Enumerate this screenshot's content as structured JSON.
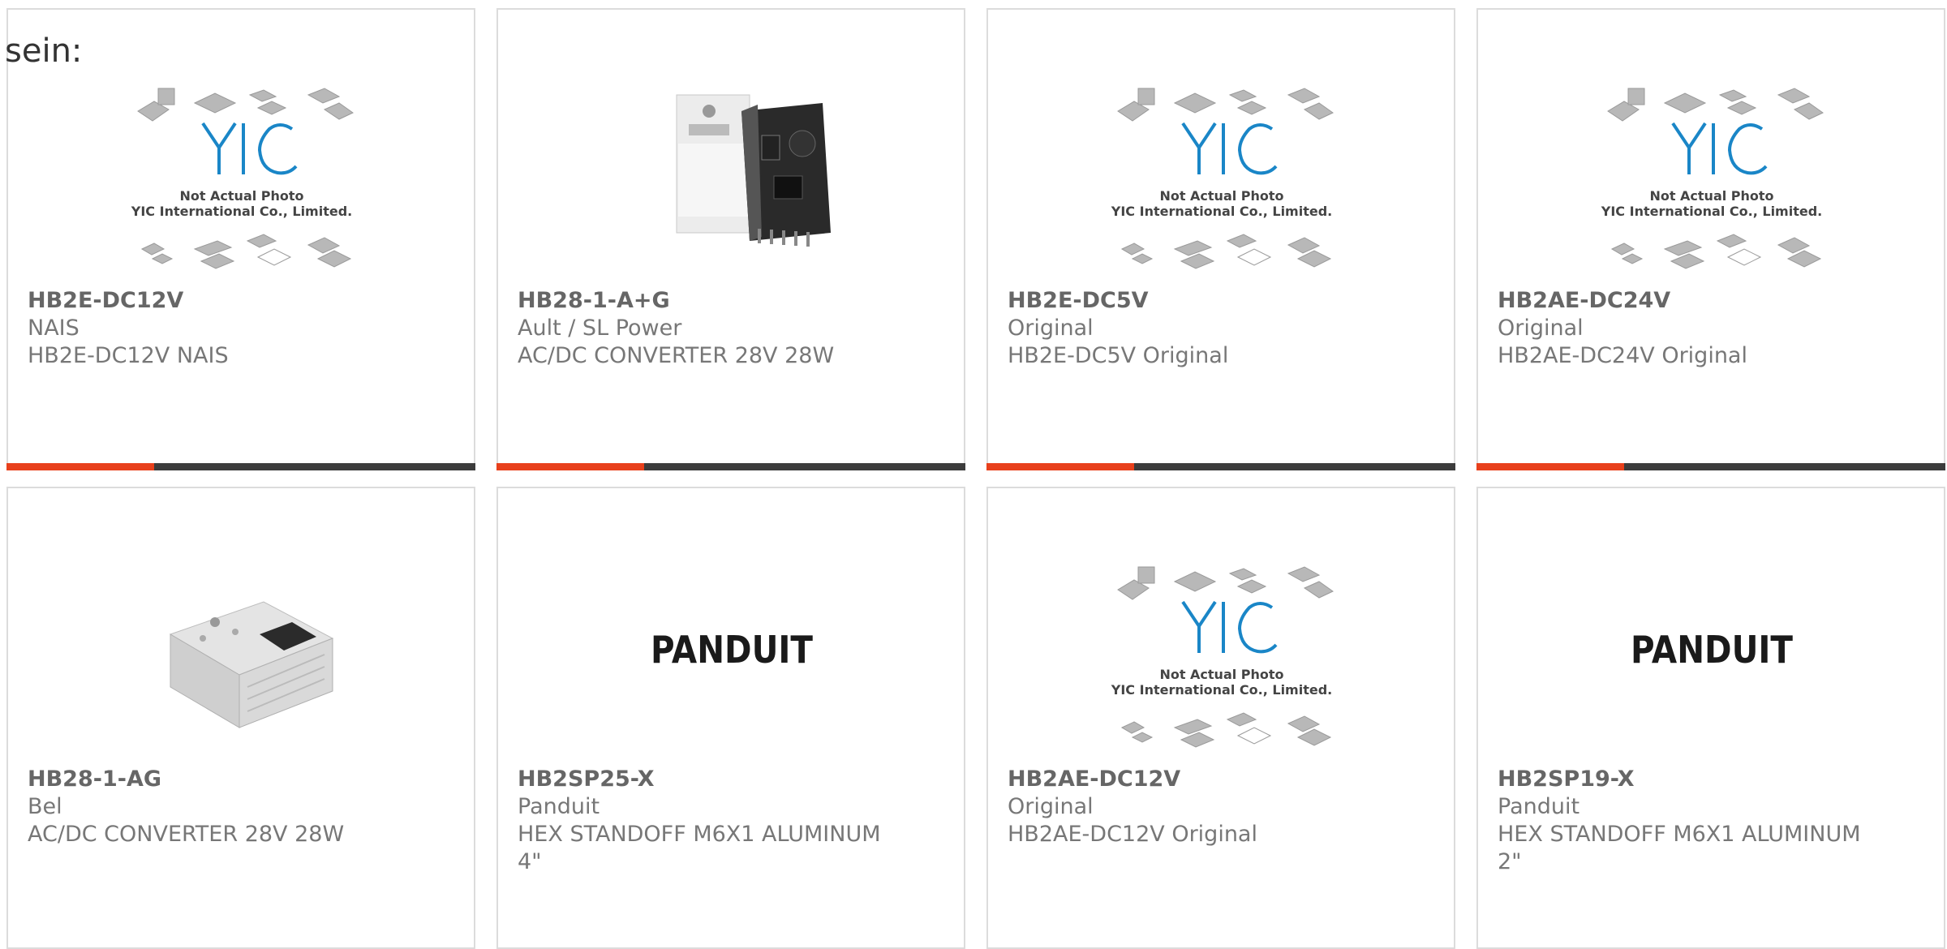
{
  "heading": "sein:",
  "placeholder": {
    "logo": "YIC",
    "line1": "Not Actual Photo",
    "line2": "YIC International Co., Limited."
  },
  "brand": {
    "panduit": "PANDUIT"
  },
  "colors": {
    "accent": "#e8401c",
    "bar": "#3c3c3c",
    "border": "#dcdcdc",
    "yic_blue": "#1a86c7"
  },
  "products": [
    {
      "part": "HB2E-DC12V",
      "mfr": "NAIS",
      "desc": "HB2E-DC12V NAIS",
      "image": "yic-placeholder"
    },
    {
      "part": "HB28-1-A+G",
      "mfr": "Ault / SL Power",
      "desc": "AC/DC CONVERTER 28V 28W",
      "image": "power-supply-open"
    },
    {
      "part": "HB2E-DC5V",
      "mfr": "Original",
      "desc": "HB2E-DC5V Original",
      "image": "yic-placeholder"
    },
    {
      "part": "HB2AE-DC24V",
      "mfr": "Original",
      "desc": "HB2AE-DC24V Original",
      "image": "yic-placeholder"
    },
    {
      "part": "HB28-1-AG",
      "mfr": "Bel",
      "desc": "AC/DC CONVERTER 28V 28W",
      "image": "power-supply-enclosed"
    },
    {
      "part": "HB2SP25-X",
      "mfr": "Panduit",
      "desc": "HEX STANDOFF M6X1 ALUMINUM\n4\"",
      "image": "panduit-logo"
    },
    {
      "part": "HB2AE-DC12V",
      "mfr": "Original",
      "desc": "HB2AE-DC12V Original",
      "image": "yic-placeholder"
    },
    {
      "part": "HB2SP19-X",
      "mfr": "Panduit",
      "desc": "HEX STANDOFF M6X1 ALUMINUM\n2\"",
      "image": "panduit-logo"
    }
  ]
}
